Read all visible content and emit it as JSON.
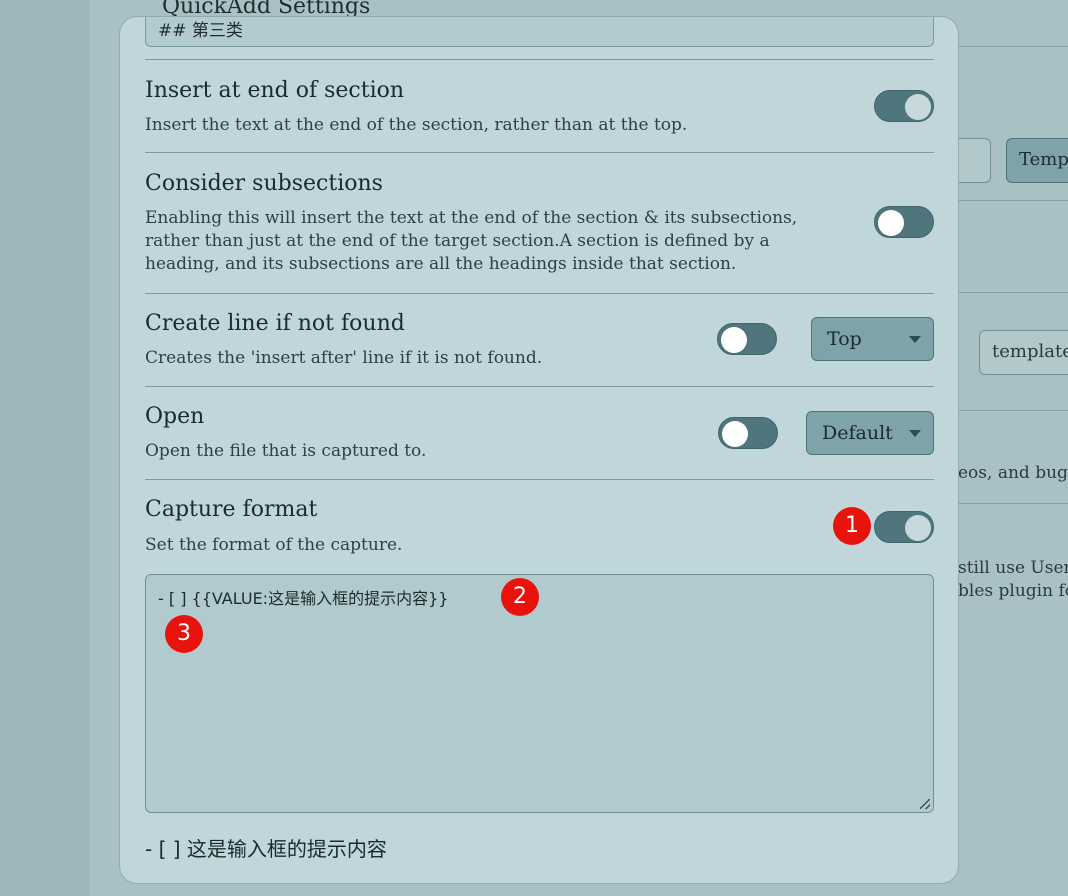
{
  "background": {
    "title": "QuickAdd Settings",
    "input_value": "",
    "button_label": "Temp",
    "template_field": "template",
    "text_line_1": "eos, and bug",
    "text_line_2": "still use User",
    "text_line_3": "bles plugin fo"
  },
  "modal": {
    "section_input_value": "## 第三类",
    "settings": [
      {
        "name": "Insert at end of section",
        "description": "Insert the text at the end of the section, rather than at the top.",
        "toggle": "on"
      },
      {
        "name": "Consider subsections",
        "description": "Enabling this will insert the text at the end of the section & its subsections, rather than just at the end of the target section.A section is defined by a heading, and its subsections are all the headings inside that section.",
        "toggle": "off"
      },
      {
        "name": "Create line if not found",
        "description": "Creates the 'insert after' line if it is not found.",
        "toggle": "off",
        "dropdown": "Top"
      },
      {
        "name": "Open",
        "description": "Open the file that is captured to.",
        "toggle": "off",
        "dropdown": "Default"
      },
      {
        "name": "Capture format",
        "description": "Set the format of the capture.",
        "toggle": "on"
      }
    ],
    "format_textarea_value": "- [ ] {{VALUE:这是输入框的提示内容}}",
    "preview_text": "- [ ] 这是输入框的提示内容"
  },
  "annotations": [
    "1",
    "2",
    "3"
  ],
  "colors": {
    "toggle_on": "#4f767c",
    "annotation_badge": "#e8130c",
    "modal_bg": "#c0d6da"
  }
}
